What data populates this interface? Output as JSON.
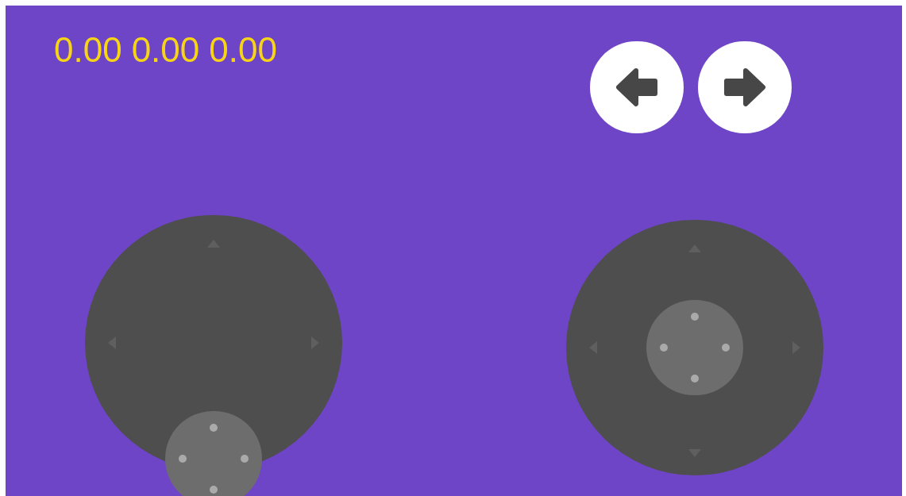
{
  "readings": [
    "0.00",
    "0.00",
    "0.00"
  ],
  "buttons": [
    {
      "kind": "left"
    },
    {
      "kind": "right"
    }
  ],
  "joysticks": [
    {
      "centered": false
    },
    {
      "centered": true
    }
  ]
}
